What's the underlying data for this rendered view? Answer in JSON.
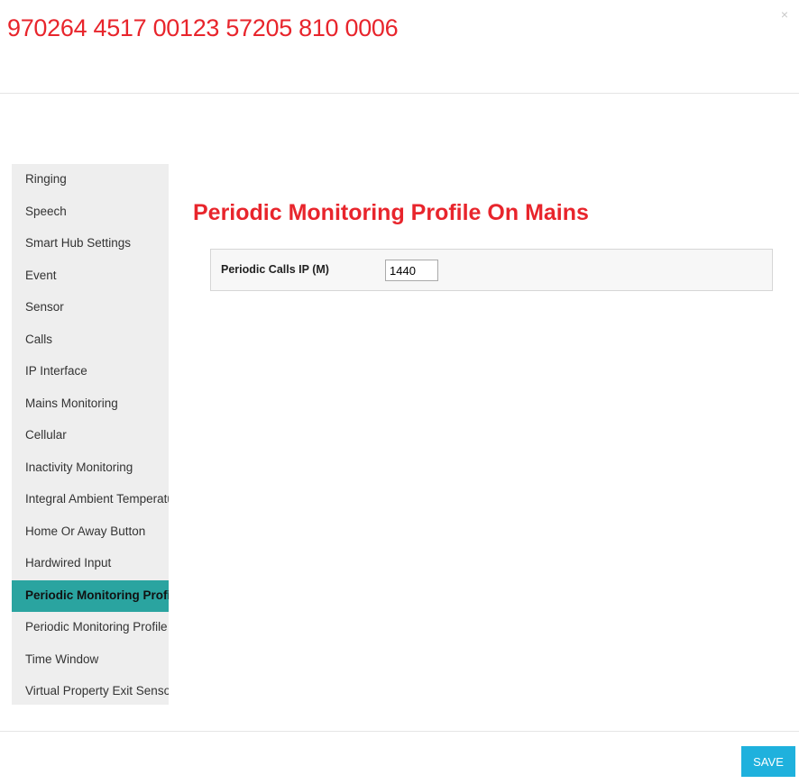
{
  "modal": {
    "title": "970264 4517 00123 57205 810 0006",
    "close_glyph": "×"
  },
  "sidebar": {
    "items": [
      {
        "label": "Ringing"
      },
      {
        "label": "Speech"
      },
      {
        "label": "Smart Hub Settings"
      },
      {
        "label": "Event"
      },
      {
        "label": "Sensor"
      },
      {
        "label": "Calls"
      },
      {
        "label": "IP Interface"
      },
      {
        "label": "Mains Monitoring"
      },
      {
        "label": "Cellular"
      },
      {
        "label": "Inactivity Monitoring"
      },
      {
        "label": "Integral Ambient Temperature"
      },
      {
        "label": "Home Or Away Button"
      },
      {
        "label": "Hardwired Input"
      },
      {
        "label": "Periodic Monitoring Profile On Mains"
      },
      {
        "label": "Periodic Monitoring Profile"
      },
      {
        "label": "Time Window"
      },
      {
        "label": "Virtual Property Exit Sensor"
      }
    ],
    "active_index": 13
  },
  "content": {
    "title": "Periodic Monitoring Profile On Mains",
    "field_label": "Periodic Calls IP (M)",
    "field_value": "1440"
  },
  "footer": {
    "save_label": "SAVE"
  },
  "colors": {
    "title": "#e8252c",
    "active_item": "#2aa4a0",
    "save_button": "#1fb1dd"
  }
}
